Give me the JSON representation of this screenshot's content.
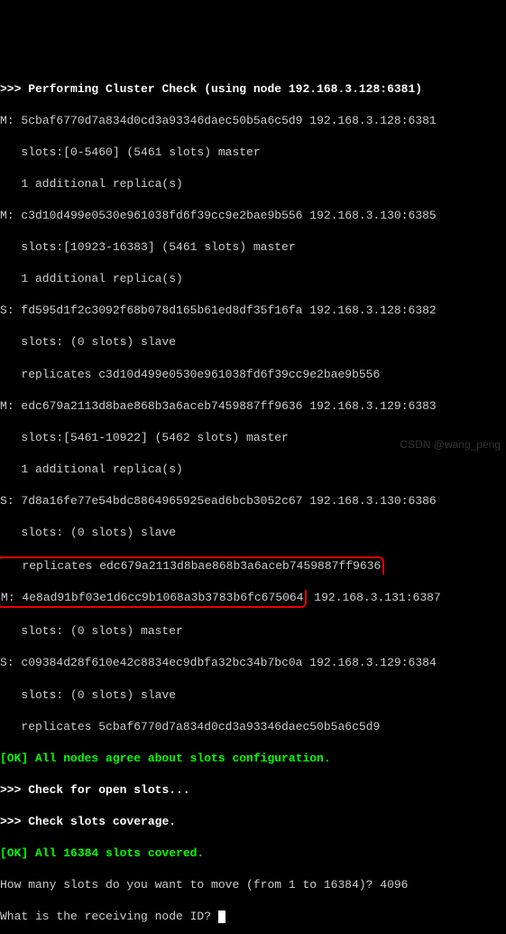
{
  "header": {
    "prefix": ">>> ",
    "title": "Performing Cluster Check (using node 192.168.3.128:6381)"
  },
  "nodes": [
    {
      "role": "M",
      "id": "5cbaf6770d7a834d0cd3a93346daec50b5a6c5d9",
      "addr": "192.168.3.128:6381",
      "slots_line": "   slots:[0-5460] (5461 slots) master",
      "extra": "   1 additional replica(s)"
    },
    {
      "role": "M",
      "id": "c3d10d499e0530e961038fd6f39cc9e2bae9b556",
      "addr": "192.168.3.130:6385",
      "slots_line": "   slots:[10923-16383] (5461 slots) master",
      "extra": "   1 additional replica(s)"
    },
    {
      "role": "S",
      "id": "fd595d1f2c3092f68b078d165b61ed8df35f16fa",
      "addr": "192.168.3.128:6382",
      "slots_line": "   slots: (0 slots) slave",
      "extra": "   replicates c3d10d499e0530e961038fd6f39cc9e2bae9b556"
    },
    {
      "role": "M",
      "id": "edc679a2113d8bae868b3a6aceb7459887ff9636",
      "addr": "192.168.3.129:6383",
      "slots_line": "   slots:[5461-10922] (5462 slots) master",
      "extra": "   1 additional replica(s)"
    },
    {
      "role": "S",
      "id": "7d8a16fe77e54bdc8864965925ead6bcb3052c67",
      "addr": "192.168.3.130:6386",
      "slots_line": "   slots: (0 slots) slave",
      "extra": "   replicates edc679a2113d8bae868b3a6aceb7459887ff9636"
    },
    {
      "role": "M",
      "id": "4e8ad91bf03e1d6cc9b1068a3b3783b6fc675064",
      "addr": "192.168.3.131:6387",
      "slots_line": "   slots: (0 slots) master",
      "extra": ""
    },
    {
      "role": "S",
      "id": "c09384d28f610e42c8834ec9dbfa32bc34b7bc0a",
      "addr": "192.168.3.129:6384",
      "slots_line": "   slots: (0 slots) slave",
      "extra": "   replicates 5cbaf6770d7a834d0cd3a93346daec50b5a6c5d9"
    }
  ],
  "ok_lines": {
    "ok1": "[OK] All nodes agree about slots configuration.",
    "check_open_prefix": ">>> ",
    "check_open": "Check for open slots...",
    "check_cov_prefix": ">>> ",
    "check_cov": "Check slots coverage.",
    "ok2": "[OK] All 16384 slots covered."
  },
  "prompts": {
    "q1": "How many slots do you want to move (from 1 to 16384)? ",
    "a1": "4096",
    "q2": "What is the receiving node ID? "
  },
  "watermark": "CSDN @wang_peng"
}
